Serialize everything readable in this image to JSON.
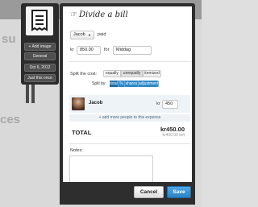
{
  "sidebar": {
    "buttons": [
      {
        "label": "+ Add image"
      },
      {
        "label": "General"
      },
      {
        "label": "Oct 6, 2012"
      },
      {
        "label": "Just this once"
      }
    ]
  },
  "dialog": {
    "title": "Divide a bill",
    "payer": "Jacob",
    "paid_label": "paid",
    "currency": "kr",
    "amount": "850.00",
    "for_label": "for",
    "description": "Middag",
    "split": {
      "label": "Split the cost:",
      "options": [
        "equally",
        "unequally",
        "itemized"
      ],
      "selected": "unequally",
      "split_by_label": "Split by:",
      "split_by_options": [
        "total",
        "%",
        "shares",
        "adjustment"
      ],
      "split_by_selected": "total"
    },
    "people": [
      {
        "name": "Jacob",
        "currency": "kr",
        "amount": "450"
      }
    ],
    "add_more_label": "+ add more people to this expense",
    "total_label": "TOTAL",
    "total_amount": "kr450.00",
    "total_left": "kr400.00 left",
    "notes_label": "Notes:",
    "notes_value": "",
    "cancel_label": "Cancel",
    "save_label": "Save"
  },
  "background": {
    "fragments": [
      "su",
      "ces"
    ]
  },
  "colors": {
    "accent": "#2d89c8",
    "save": "#2a82c4",
    "modal_frame": "#2e2e2e"
  }
}
